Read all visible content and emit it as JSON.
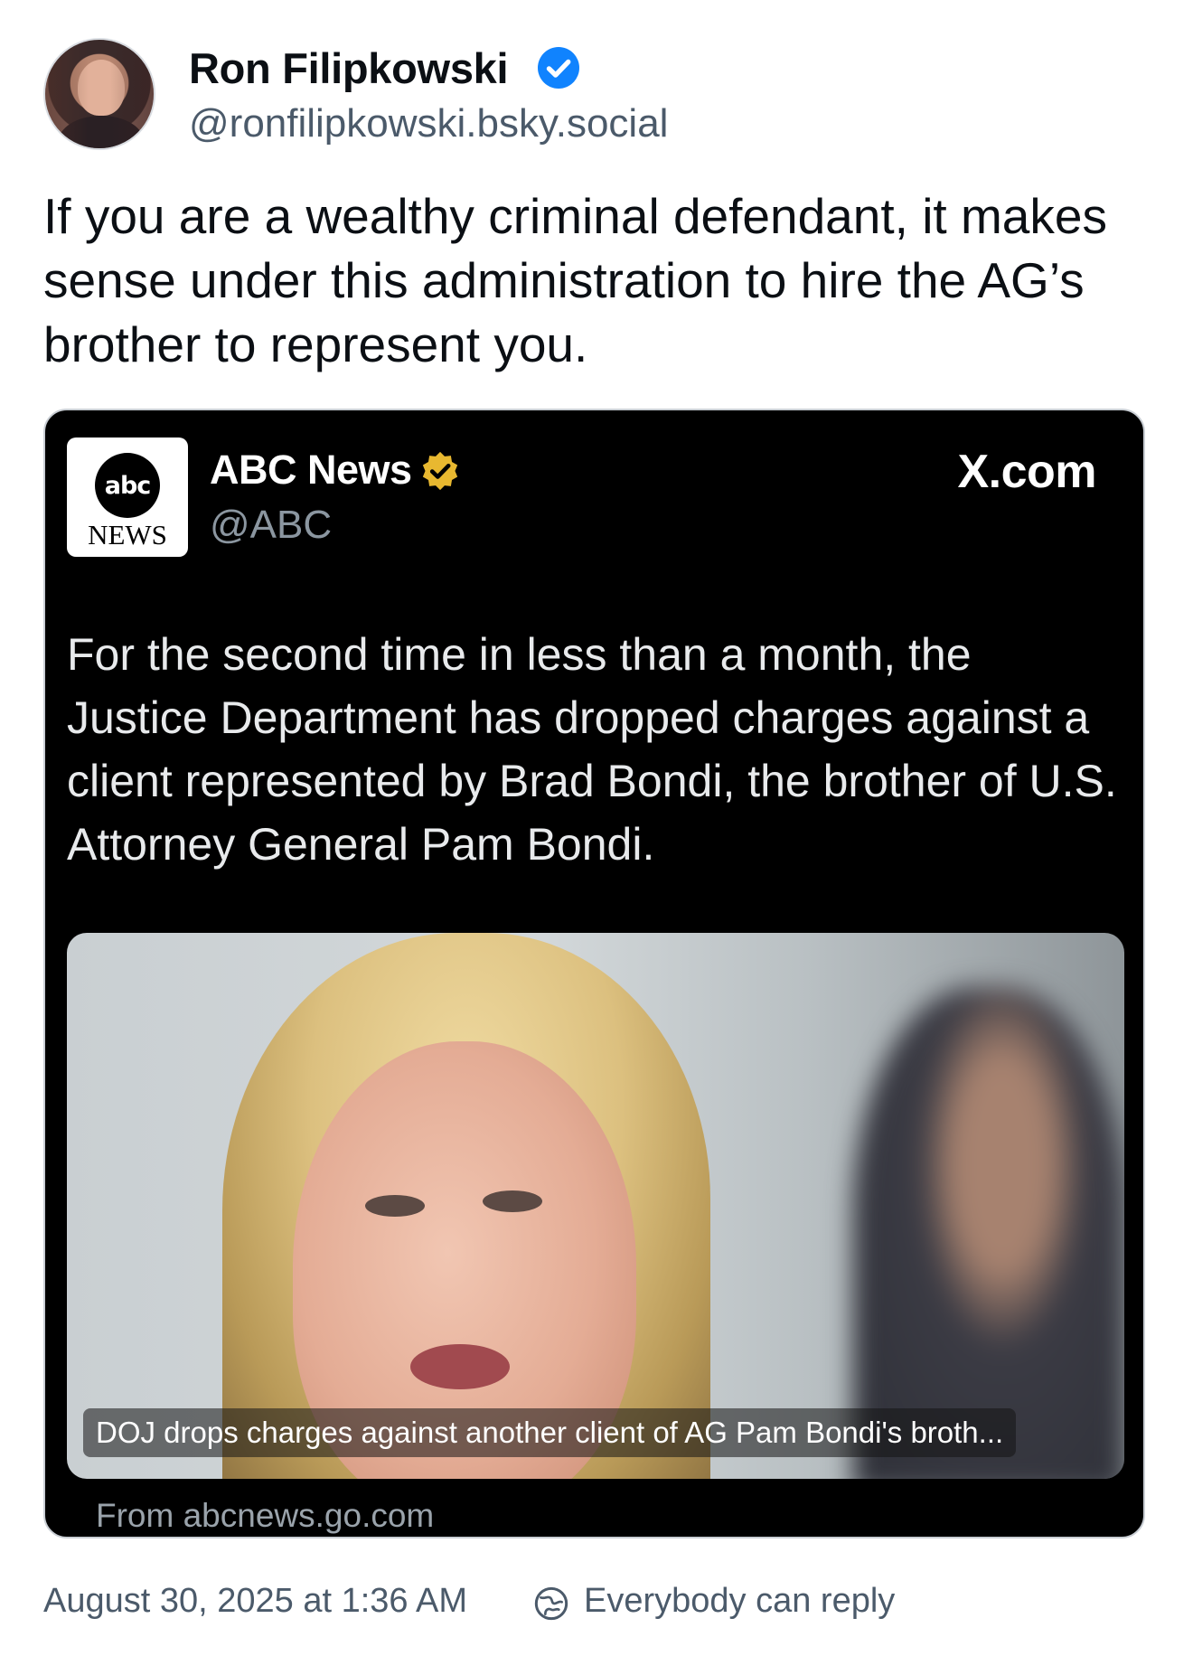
{
  "author": {
    "name": "Ron Filipkowski",
    "handle": "@ronfilipkowski.bsky.social",
    "verified_icon": "verified-check-icon",
    "verified_color": "#1083fe"
  },
  "post": {
    "text": "If you are a wealthy criminal defendant, it makes sense under this administration to hire the AG’s brother to represent you."
  },
  "embed": {
    "logo_top": "abc",
    "logo_bottom": "NEWS",
    "account_name": "ABC News",
    "account_handle": "@ABC",
    "badge_icon": "gold-verified-icon",
    "badge_color": "#e8b830",
    "site": "X.com",
    "text": "For the second time in less than a month, the Justice Department has dropped charges against a client represented by Brad Bondi, the brother of U.S. Attorney General Pam Bondi.",
    "photo_caption": "DOJ drops charges against another client of AG Pam Bondi's broth...",
    "source": "From abcnews.go.com"
  },
  "footer": {
    "timestamp": "August 30, 2025 at 1:36 AM",
    "reply_setting": "Everybody can reply",
    "reply_icon": "globe-reply-icon"
  }
}
